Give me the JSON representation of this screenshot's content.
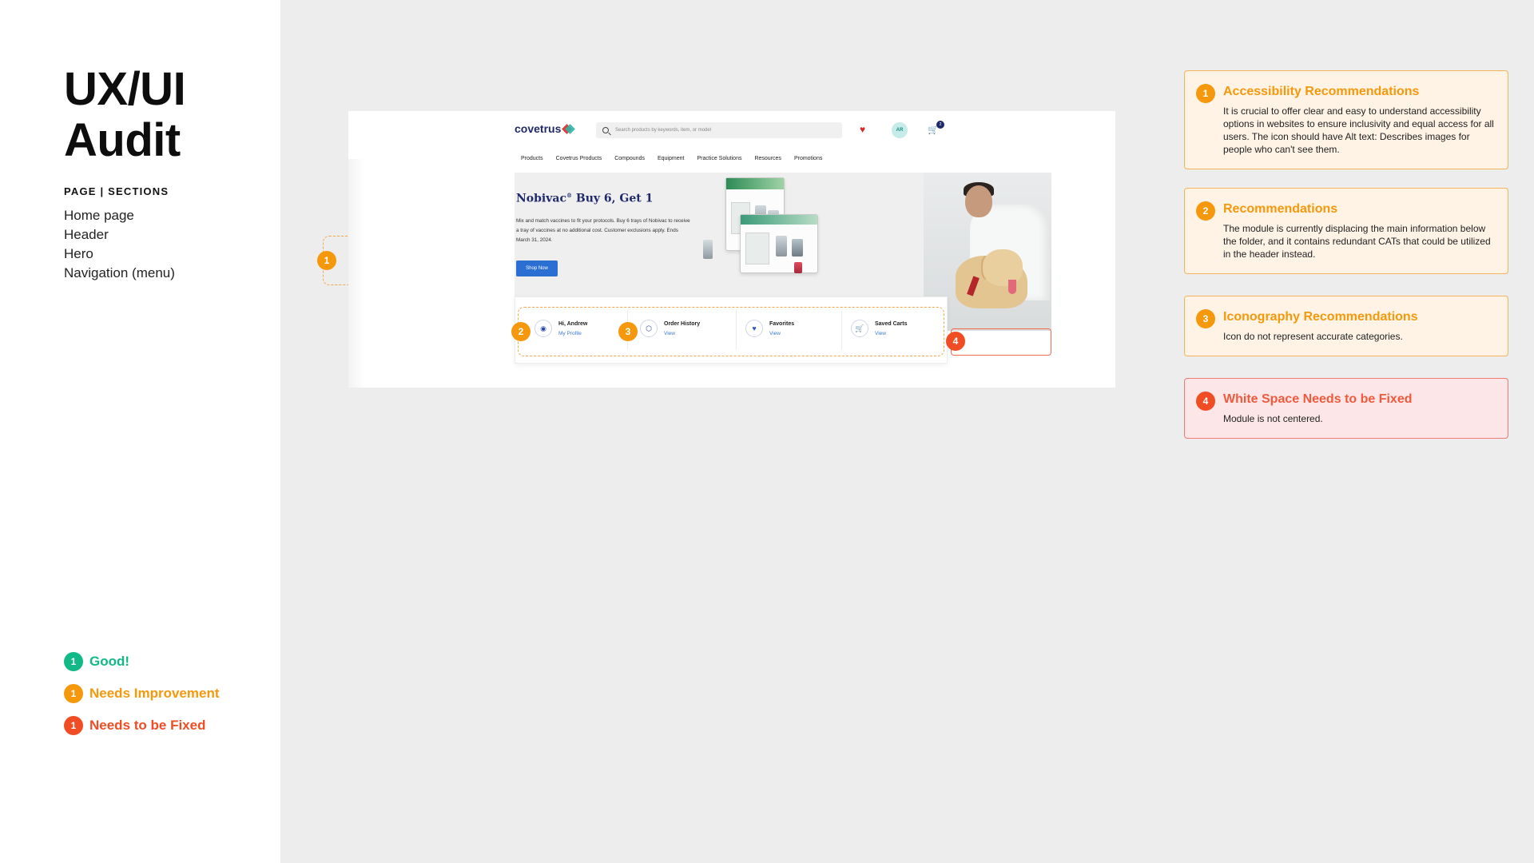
{
  "audit": {
    "title_line1": "UX/UI",
    "title_line2": "Audit",
    "sections_heading": "PAGE | SECTIONS",
    "sections": [
      "Home page",
      "Header",
      "Hero",
      "Navigation (menu)"
    ]
  },
  "legend": [
    {
      "number": "1",
      "label": "Good!",
      "color": "#12b886"
    },
    {
      "number": "1",
      "label": "Needs Improvement",
      "color": "#f5980b"
    },
    {
      "number": "1",
      "label": "Needs to be Fixed",
      "color": "#f04d24"
    }
  ],
  "site": {
    "logo": "covetrus",
    "search_placeholder": "Search products by keywords, item, or model",
    "avatar_initials": "AR",
    "cart_count": "2",
    "nav": [
      "Products",
      "Covetrus Products",
      "Compounds",
      "Equipment",
      "Practice Solutions",
      "Resources",
      "Promotions"
    ],
    "hero": {
      "title": "Nobivac",
      "title_reg": "®",
      "title_suffix": " Buy 6, Get 1",
      "body": "Mix and match vaccines to fit your protocols. Buy 6 trays of Nobivac to receive a tray of vaccines at no additional cost. Customer exclusions apply. Ends March 31, 2024.",
      "cta": "Shop Now"
    },
    "quick_links": [
      {
        "title": "Hi, Andrew",
        "link": "My Profile",
        "icon": "user-icon"
      },
      {
        "title": "Order History",
        "link": "View",
        "icon": "box-icon"
      },
      {
        "title": "Favorites",
        "link": "View",
        "icon": "heart-icon"
      },
      {
        "title": "Saved Carts",
        "link": "View",
        "icon": "cart-icon"
      }
    ]
  },
  "markers": {
    "m1": "1",
    "m2": "2",
    "m3": "3",
    "m4": "4"
  },
  "cards": [
    {
      "number": "1",
      "title": "Accessibility Recommendations",
      "body": "It is crucial to offer clear and easy to understand accessibility options in websites to ensure inclusivity and equal access for all users. The icon should have Alt text: Describes images for people who can't see them.",
      "severity": "improvement"
    },
    {
      "number": "2",
      "title": "Recommendations",
      "body": "The module is currently displacing the main information below the folder, and it contains redundant CATs that could be utilized in the header instead.",
      "severity": "improvement"
    },
    {
      "number": "3",
      "title": "Iconography Recommendations",
      "body": "Icon do not represent accurate categories.",
      "severity": "improvement"
    },
    {
      "number": "4",
      "title": "White Space Needs to be Fixed",
      "body": "Module is not centered.",
      "severity": "fix"
    }
  ],
  "colors": {
    "good": "#12b886",
    "improvement": "#f5980b",
    "fix": "#f04d24",
    "brand_navy": "#1f2a6b"
  }
}
